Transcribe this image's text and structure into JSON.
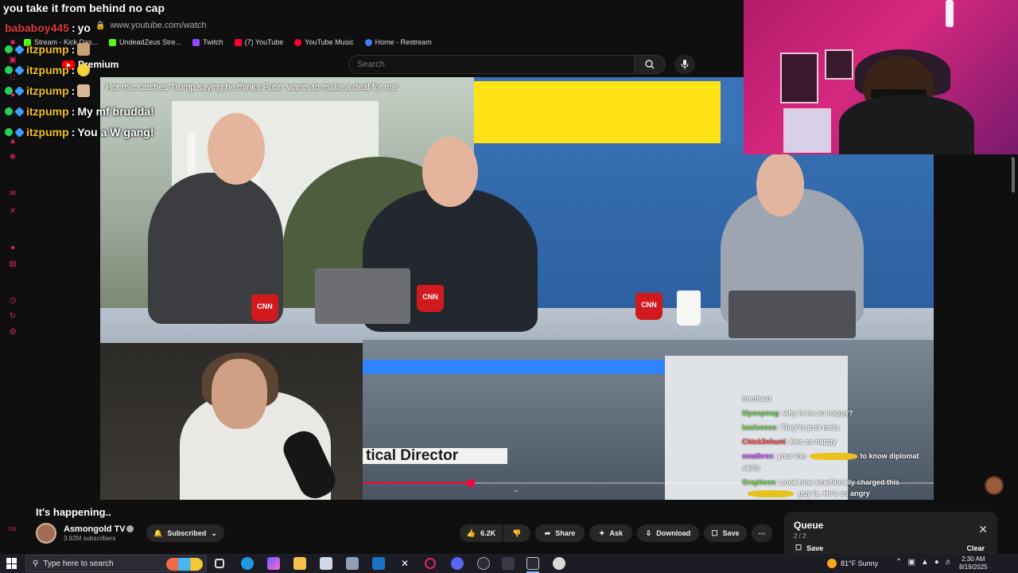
{
  "browser": {
    "url": "www.youtube.com/watch",
    "bookmarks": [
      {
        "label": "Stream - Kick Das...",
        "color": "#53fc18"
      },
      {
        "label": "UndeadZeus Stre...",
        "color": "#53fc18"
      },
      {
        "label": "Twitch",
        "color": "#9146ff"
      },
      {
        "label": "(7) YouTube",
        "color": "#ff0033"
      },
      {
        "label": "YouTube Music",
        "color": "#ff0033"
      },
      {
        "label": "Home - Restream",
        "color": "#3b82f6"
      }
    ]
  },
  "youtube": {
    "logo_text": "Premium",
    "search_placeholder": "Search",
    "video_overlay_title": "Hot mic catches Trump saying he thinks Putin 'wants to make a deal for me'",
    "lower_third": "tical Director",
    "progress_fraction": 0.19,
    "title": "It's happening..",
    "channel_name": "Asmongold TV",
    "subscribers": "3.92M subscribers",
    "subscribed_label": "Subscribed",
    "like_count": "6.2K",
    "share_label": "Share",
    "ask_label": "Ask",
    "download_label": "Download",
    "save_label": "Save"
  },
  "queue": {
    "title": "Queue",
    "count": "2 / 2",
    "save_label": "Save",
    "clear_label": "Clear"
  },
  "overlay_chat": {
    "top_line": "you take it from behind no cap",
    "lines": [
      {
        "user": "bababoy445",
        "color": "#e03a3a",
        "message": "yo"
      },
      {
        "user": "itzpump",
        "color": "#f2c21c",
        "message": ""
      },
      {
        "user": "itzpump",
        "color": "#f2c21c",
        "message": ""
      },
      {
        "user": "itzpump",
        "color": "#f2c21c",
        "message": ""
      },
      {
        "user": "itzpump",
        "color": "#f2c21c",
        "message": "My mf brudda!"
      },
      {
        "user": "itzpump",
        "color": "#f2c21c",
        "message": "You a W gang!"
      }
    ]
  },
  "video_chat": [
    {
      "user": "",
      "color": "#ffffff",
      "message": "involved"
    },
    {
      "user": "lilpoopnug",
      "color": "#7ed957",
      "message": "why is he so happy?"
    },
    {
      "user": "kaelsense",
      "color": "#7ed957",
      "message": "They're just meta"
    },
    {
      "user": "Chick3nhunt",
      "color": "#ff4d4d",
      "message": "Hes so happy"
    },
    {
      "user": "swathrex",
      "color": "#c35cff",
      "message": "your too",
      "message2": "to know diplomat"
    },
    {
      "user": "",
      "color": "#ffffff",
      "message": "skills"
    },
    {
      "user": "Grapheen",
      "color": "#7ed957",
      "message": "Look how emotionally charged this"
    },
    {
      "user": "",
      "color": "#ffffff",
      "message": "guy is. He's so angry"
    }
  ],
  "taskbar": {
    "search_placeholder": "Type here to search",
    "weather": "81°F  Sunny",
    "time": "2:30 AM",
    "date": "8/19/2025"
  },
  "colors": {
    "youtube_red": "#ff0033",
    "chat_green_badge": "#27d35b",
    "chat_blue_badge": "#3aa0ff"
  }
}
